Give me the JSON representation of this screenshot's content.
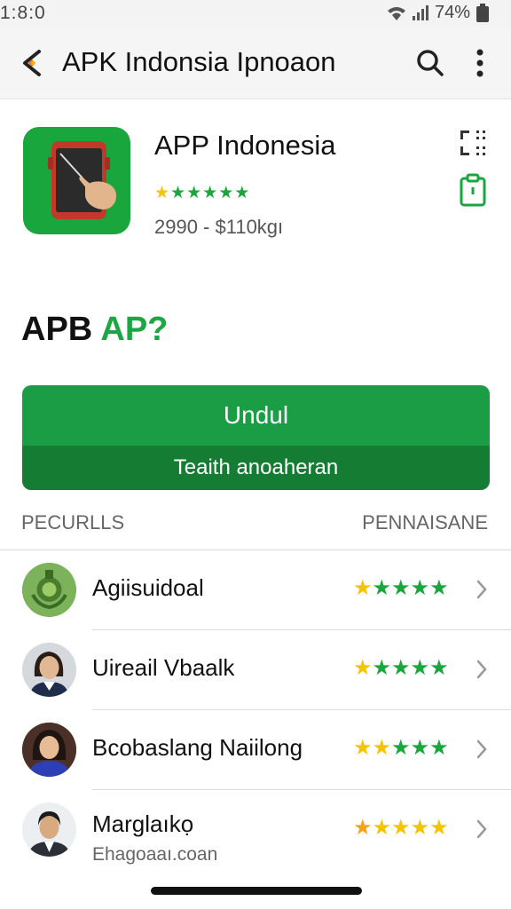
{
  "status_bar": {
    "time": "1:8:0",
    "battery": "74%"
  },
  "app_bar": {
    "title": "APK Indonsia Iрnoaon"
  },
  "app": {
    "name": "APP Indonesia",
    "rating_stars": 5,
    "meta": "2990 - $110kgı",
    "icon_name": "tablet-hand-app-icon",
    "accent": "#19a63d"
  },
  "headline": {
    "part_a": "APB",
    "part_b": "AP?"
  },
  "actions": {
    "download_label": "Undul",
    "secondary_label": "Teaith anoaheran"
  },
  "section": {
    "left_label": "PECURLLS",
    "right_label": "PENNAISANE"
  },
  "colors": {
    "primary_green": "#1a9d45",
    "dark_green": "#147d33",
    "star_yellow": "#f5c400",
    "star_green": "#19a63d",
    "star_orange": "#f4a21b"
  },
  "list": [
    {
      "name": "Agiisuidoal",
      "subtitle": "",
      "avatar": "green-emblem-avatar",
      "stars": [
        "y",
        "g",
        "g",
        "g",
        "g"
      ]
    },
    {
      "name": "Uireail Vbaalk",
      "subtitle": "",
      "avatar": "woman-portrait-avatar",
      "stars": [
        "y",
        "g",
        "g",
        "g",
        "g"
      ]
    },
    {
      "name": "Bcobaslang Naiilong",
      "subtitle": "",
      "avatar": "woman-blue-portrait-avatar",
      "stars": [
        "y",
        "y",
        "g",
        "g",
        "g"
      ]
    },
    {
      "name": "Marglaıkọ",
      "subtitle": "Ehagoaaı.coan",
      "avatar": "man-portrait-avatar",
      "stars": [
        "o",
        "y",
        "y",
        "y",
        "y"
      ]
    }
  ]
}
